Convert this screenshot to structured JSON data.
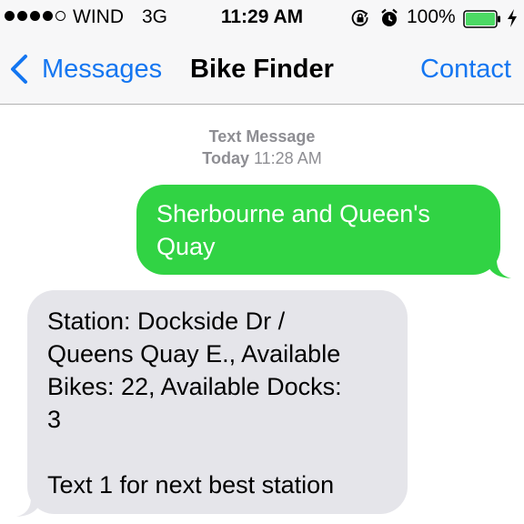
{
  "status_bar": {
    "carrier": "WIND",
    "network": "3G",
    "time": "11:29 AM",
    "battery_percent": "100%",
    "signal_bars": 4,
    "signal_total": 5,
    "icons": [
      "rotation-lock-icon",
      "alarm-icon",
      "battery-icon",
      "charging-icon"
    ]
  },
  "nav": {
    "back_label": "Messages",
    "title": "Bike Finder",
    "contact_label": "Contact"
  },
  "thread": {
    "header_type": "Text Message",
    "header_day": "Today",
    "header_time": "11:28 AM",
    "messages": [
      {
        "direction": "outgoing",
        "lines": [
          "Sherbourne and Queen's",
          "Quay"
        ]
      },
      {
        "direction": "incoming",
        "lines": [
          "Station: Dockside Dr /",
          "Queens Quay E., Available",
          "Bikes: 22, Available Docks:",
          "3",
          "",
          "Text 1 for next best station"
        ]
      }
    ]
  },
  "colors": {
    "accent": "#1476f1",
    "outgoing_bubble": "#31d344",
    "incoming_bubble": "#e5e5ea",
    "meta_text": "#8e8e93"
  }
}
